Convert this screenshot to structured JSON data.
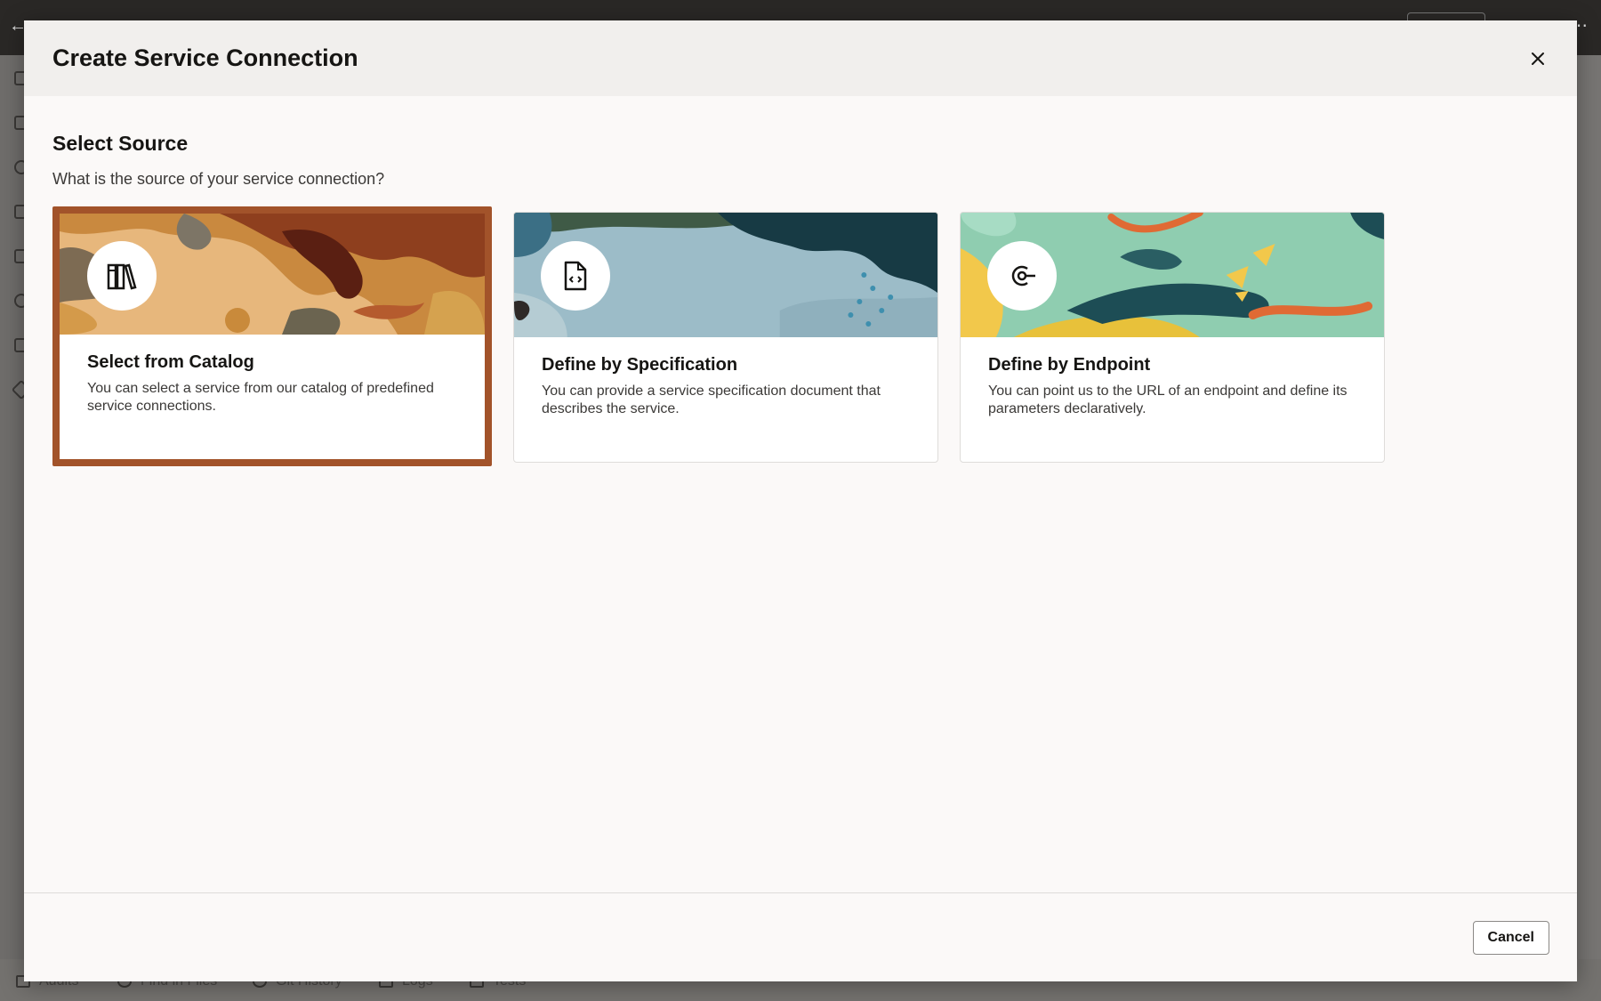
{
  "background_app": {
    "bottom_tabs": [
      {
        "label": "Audits",
        "icon": "audit-icon"
      },
      {
        "label": "Find in Files",
        "icon": "search-icon"
      },
      {
        "label": "Git History",
        "icon": "history-icon"
      },
      {
        "label": "Logs",
        "icon": "logs-icon"
      },
      {
        "label": "Tests",
        "icon": "tests-icon"
      }
    ]
  },
  "dialog": {
    "title": "Create Service Connection",
    "close_icon": "close-icon",
    "section_title": "Select Source",
    "section_subtitle": "What is the source of your service connection?",
    "cards": [
      {
        "title": "Select from Catalog",
        "description": "You can select a service from our catalog of predefined service connections.",
        "icon": "catalog-icon",
        "selected": true
      },
      {
        "title": "Define by Specification",
        "description": "You can provide a service specification document that describes the service.",
        "icon": "code-document-icon",
        "selected": false
      },
      {
        "title": "Define by Endpoint",
        "description": "You can point us to the URL of an endpoint and define its parameters declaratively.",
        "icon": "endpoint-icon",
        "selected": false
      }
    ],
    "cancel_label": "Cancel"
  },
  "colors": {
    "selected_border": "#a2532a",
    "modal_background": "#fbf9f8",
    "header_background": "#f1efed"
  }
}
